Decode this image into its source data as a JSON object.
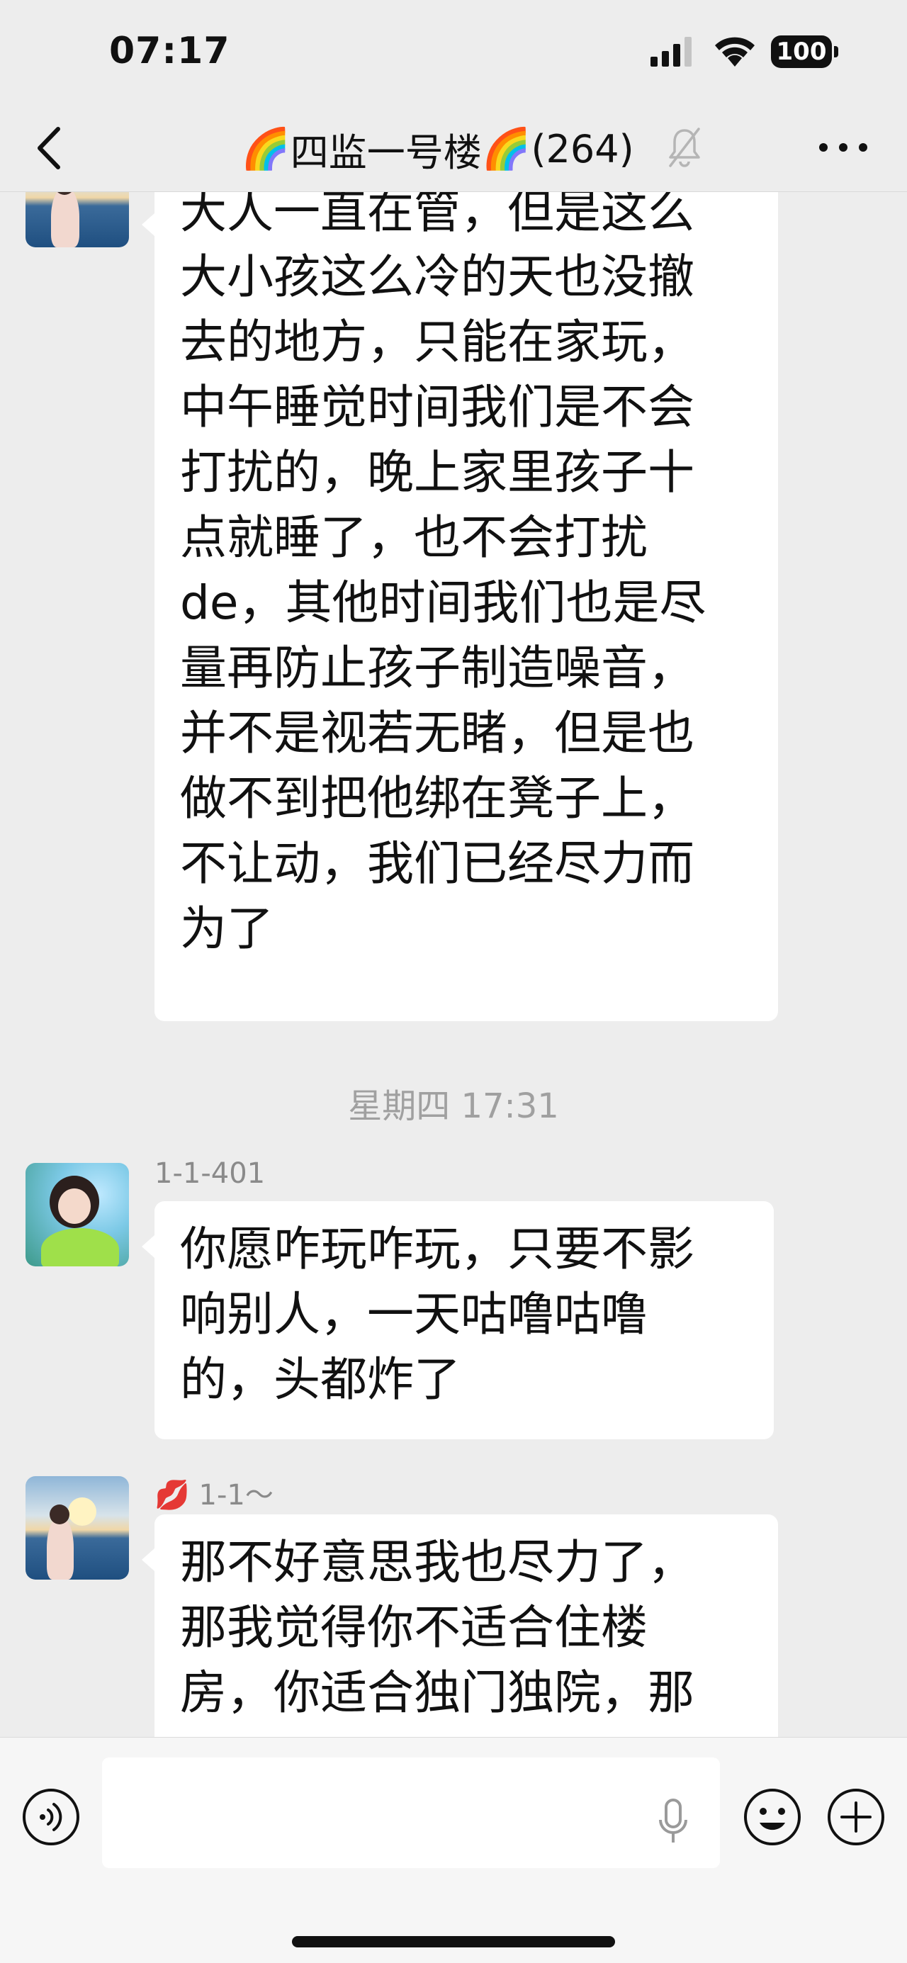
{
  "status_bar": {
    "time": "07:17",
    "battery": "100"
  },
  "nav": {
    "title_emoji_left": "🌈",
    "title_text": "四监一号楼",
    "title_emoji_right": "🌈",
    "member_count": "(264)",
    "icons": {
      "back": "chevron-left-icon",
      "mute": "bell-muted-icon",
      "more": "more-dots-icon"
    }
  },
  "chat": {
    "messages": [
      {
        "sender": "",
        "avatar": "sea-avatar",
        "text": "大人一直在管，但是这么\n大小孩这么冷的天也没撤\n去的地方，只能在家玩，\n中午睡觉时间我们是不会\n打扰的，晚上家里孩子十\n点就睡了，也不会打扰\nde，其他时间我们也是尽\n量再防止孩子制造噪音，\n并不是视若无睹，但是也\n做不到把他绑在凳子上，\n不让动，我们已经尽力而\n为了"
      },
      {
        "sender": "1-1-401",
        "avatar": "green-sweater-avatar",
        "text": "你愿咋玩咋玩，只要不影\n响别人，一天咕噜咕噜\n的，头都炸了"
      },
      {
        "sender_emoji": "💋",
        "sender": "1-1～",
        "avatar": "sea-avatar",
        "text": "那不好意思我也尽力了，\n那我觉得你不适合住楼\n房，你适合独门独院，那"
      }
    ],
    "timestamp": "星期四 17:31"
  },
  "input_bar": {
    "placeholder": "",
    "icons": {
      "voice": "voice-mode-icon",
      "mic": "microphone-icon",
      "emoji": "emoji-icon",
      "plus": "plus-icon"
    }
  },
  "colors": {
    "background": "#ededed",
    "bubble": "#ffffff",
    "meta_text": "#a0a0a0"
  }
}
